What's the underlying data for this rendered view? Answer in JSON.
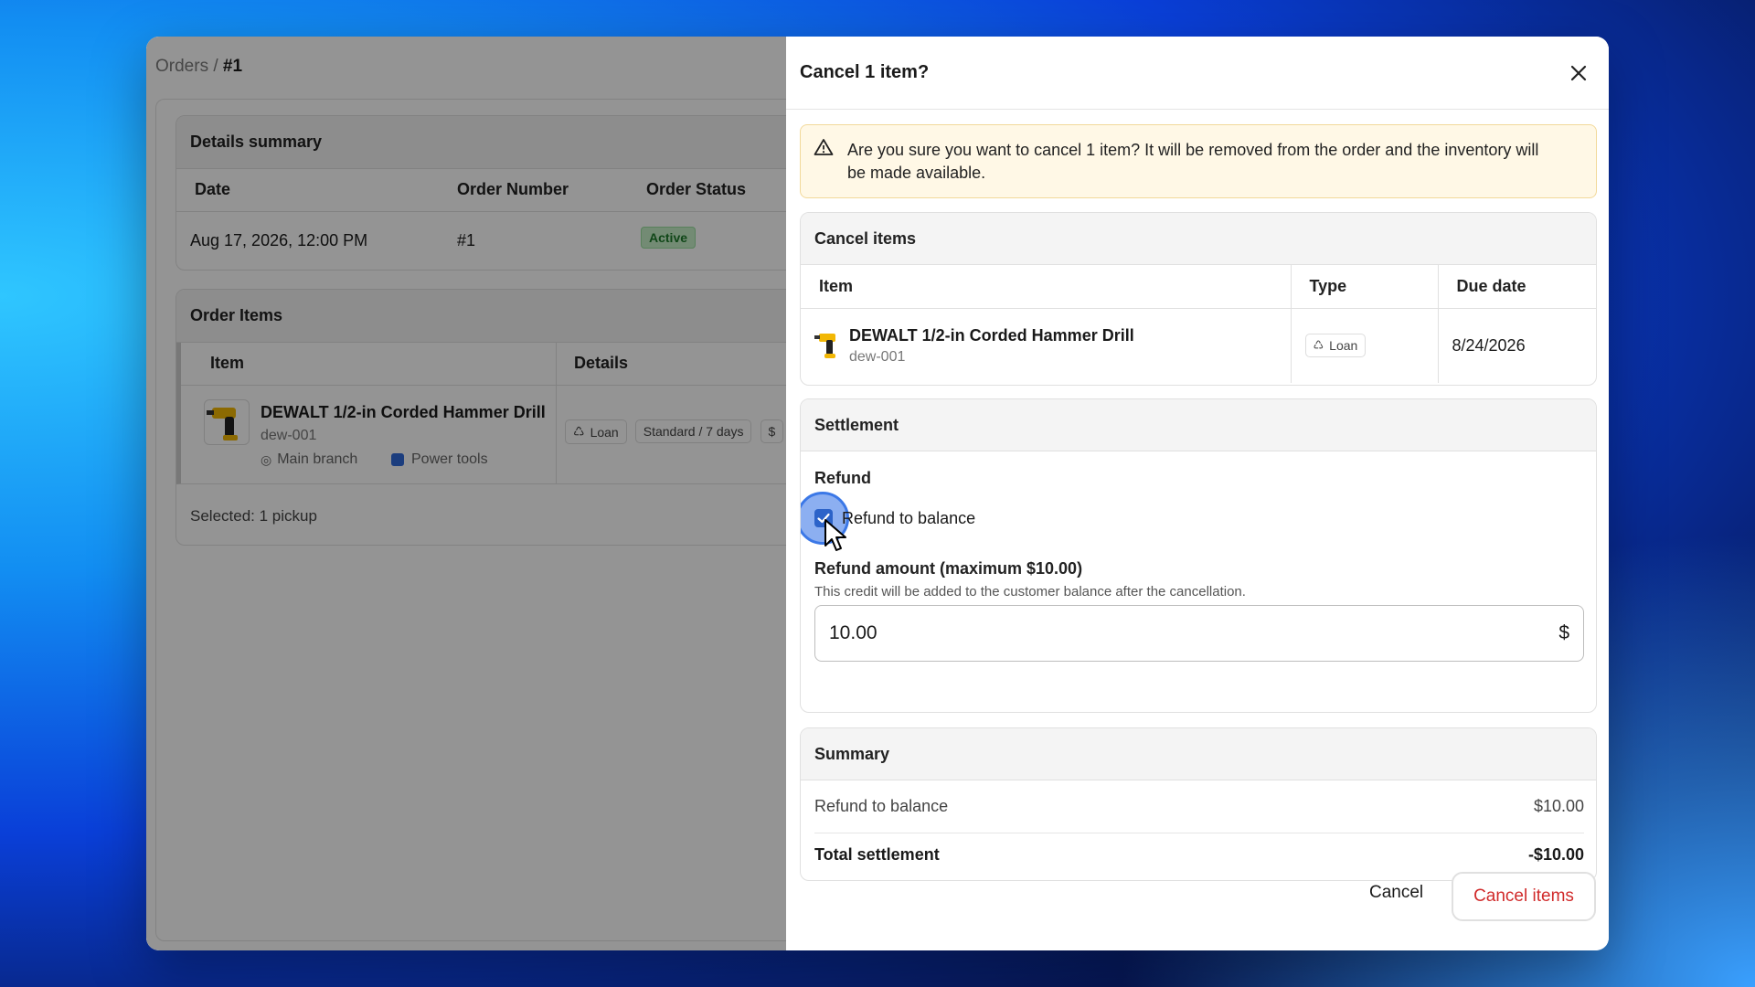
{
  "background_app": {
    "breadcrumb": {
      "parent": "Orders",
      "separator": "/",
      "current": "#1"
    },
    "details_summary": {
      "title": "Details summary",
      "columns": [
        "Date",
        "Order Number",
        "Order Status"
      ],
      "row": {
        "date": "Aug 17, 2026, 12:00 PM",
        "order_number": "#1",
        "status": "Active"
      }
    },
    "order_items": {
      "title": "Order Items",
      "columns": [
        "Item",
        "Details"
      ],
      "item": {
        "name": "DEWALT 1/2-in Corded Hammer Drill",
        "sku": "dew-001",
        "location": "Main branch",
        "category": "Power tools",
        "chips": [
          "Loan",
          "Standard / 7 days",
          "$"
        ]
      },
      "footer": "Selected: 1 pickup"
    }
  },
  "drawer": {
    "title": "Cancel 1 item?",
    "warning": "Are you sure you want to cancel 1 item? It will be removed from the order and the inventory will be made available.",
    "cancel_items": {
      "title": "Cancel items",
      "columns": [
        "Item",
        "Type",
        "Due date"
      ],
      "rows": [
        {
          "name": "DEWALT 1/2-in Corded Hammer Drill",
          "sku": "dew-001",
          "type": "Loan",
          "due_date": "8/24/2026"
        }
      ]
    },
    "settlement": {
      "title": "Settlement",
      "refund_label": "Refund",
      "checkbox_label": "Refund to balance",
      "checkbox_checked": true,
      "amount_label": "Refund amount (maximum $10.00)",
      "amount_help": "This credit will be added to the customer balance after the cancellation.",
      "amount_value": "10.00",
      "currency_symbol": "$"
    },
    "summary": {
      "title": "Summary",
      "refund_label": "Refund to balance",
      "refund_value": "$10.00",
      "total_label": "Total settlement",
      "total_value": "-$10.00"
    },
    "buttons": {
      "cancel": "Cancel",
      "confirm": "Cancel items"
    }
  },
  "colors": {
    "accent_red": "#d12b2b",
    "checkbox_blue": "#2c63c9",
    "warning_bg": "#fff8e6",
    "status_green": "#1d7a2a"
  }
}
